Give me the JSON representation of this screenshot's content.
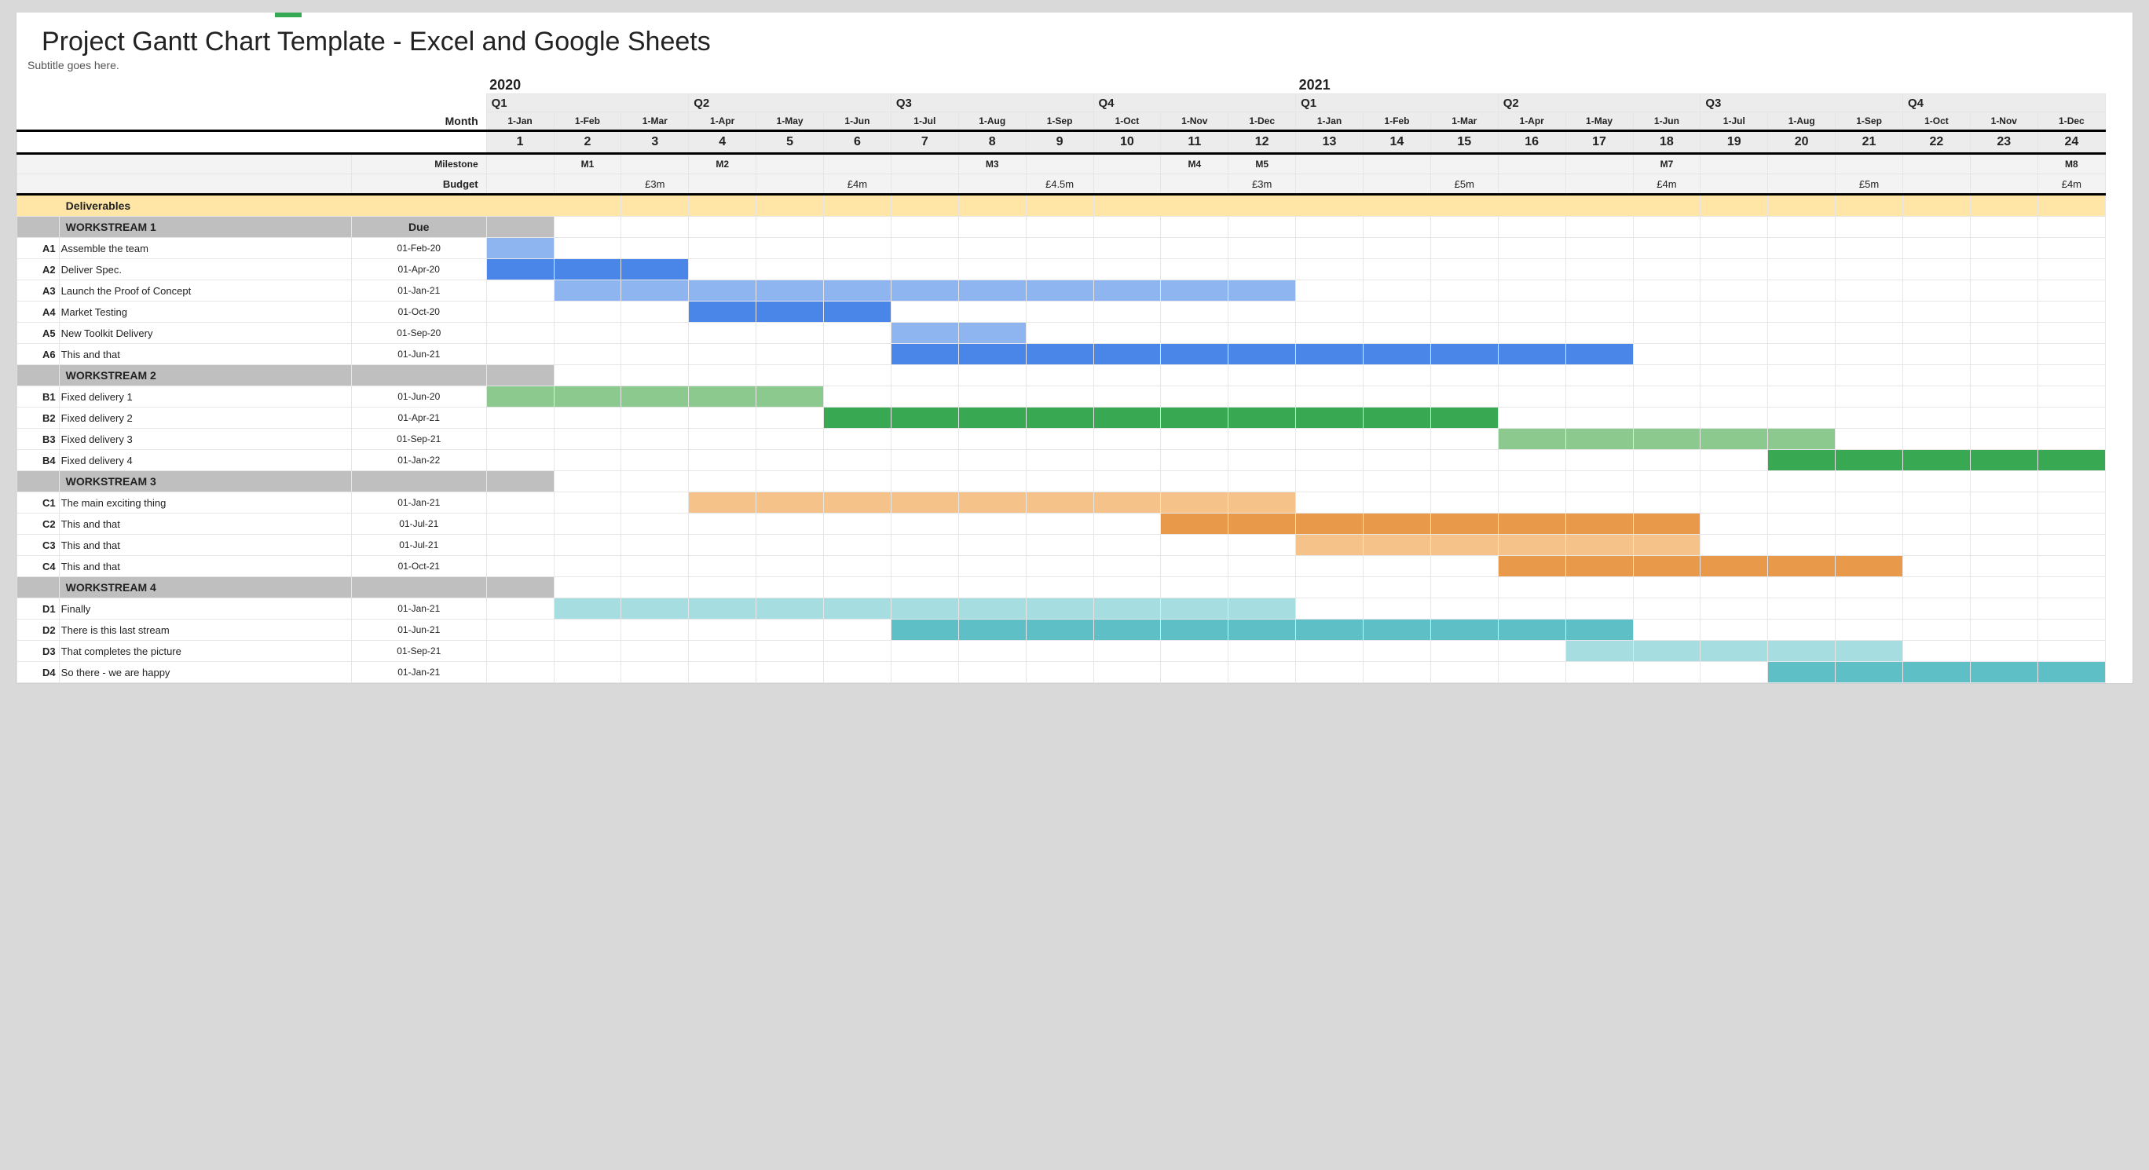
{
  "title": "Project Gantt Chart Template - Excel and Google Sheets",
  "subtitle": "Subtitle goes here.",
  "labels": {
    "month": "Month",
    "milestone": "Milestone",
    "budget": "Budget",
    "deliverables": "Deliverables",
    "due": "Due"
  },
  "years": [
    {
      "label": "2020",
      "col": 0
    },
    {
      "label": "2021",
      "col": 12
    }
  ],
  "quarters": [
    "Q1",
    "Q2",
    "Q3",
    "Q4",
    "Q1",
    "Q2",
    "Q3",
    "Q4"
  ],
  "months": [
    "1-Jan",
    "1-Feb",
    "1-Mar",
    "1-Apr",
    "1-May",
    "1-Jun",
    "1-Jul",
    "1-Aug",
    "1-Sep",
    "1-Oct",
    "1-Nov",
    "1-Dec",
    "1-Jan",
    "1-Feb",
    "1-Mar",
    "1-Apr",
    "1-May",
    "1-Jun",
    "1-Jul",
    "1-Aug",
    "1-Sep",
    "1-Oct",
    "1-Nov",
    "1-Dec"
  ],
  "month_nums": [
    "1",
    "2",
    "3",
    "4",
    "5",
    "6",
    "7",
    "8",
    "9",
    "10",
    "11",
    "12",
    "13",
    "14",
    "15",
    "16",
    "17",
    "18",
    "19",
    "20",
    "21",
    "22",
    "23",
    "24"
  ],
  "milestones": [
    "",
    "M1",
    "",
    "M2",
    "",
    "",
    "",
    "M3",
    "",
    "",
    "M4",
    "M5",
    "",
    "",
    "",
    "",
    "",
    "M7",
    "",
    "",
    "",
    "",
    "",
    "M8"
  ],
  "budgets": [
    "",
    "",
    "£3m",
    "",
    "",
    "£4m",
    "",
    "",
    "£4.5m",
    "",
    "",
    "£3m",
    "",
    "",
    "£5m",
    "",
    "",
    "£4m",
    "",
    "",
    "£5m",
    "",
    "",
    "£4m"
  ],
  "workstreams": [
    {
      "name": "WORKSTREAM 1",
      "color_main": "blue1",
      "color_light": "blue2",
      "tasks": [
        {
          "code": "A1",
          "name": "Assemble the team",
          "due": "01-Feb-20",
          "start": 0,
          "end": 0,
          "shade": "light"
        },
        {
          "code": "A2",
          "name": "Deliver Spec.",
          "due": "01-Apr-20",
          "start": 0,
          "end": 2,
          "shade": "main"
        },
        {
          "code": "A3",
          "name": "Launch the Proof of Concept",
          "due": "01-Jan-21",
          "start": 1,
          "end": 11,
          "shade": "light"
        },
        {
          "code": "A4",
          "name": "Market Testing",
          "due": "01-Oct-20",
          "start": 3,
          "end": 5,
          "shade": "main"
        },
        {
          "code": "A5",
          "name": "New Toolkit Delivery",
          "due": "01-Sep-20",
          "start": 6,
          "end": 7,
          "shade": "light"
        },
        {
          "code": "A6",
          "name": "This and that",
          "due": "01-Jun-21",
          "start": 6,
          "end": 16,
          "shade": "main"
        }
      ]
    },
    {
      "name": "WORKSTREAM 2",
      "color_main": "green1",
      "color_light": "green2",
      "tasks": [
        {
          "code": "B1",
          "name": "Fixed delivery 1",
          "due": "01-Jun-20",
          "start": 0,
          "end": 4,
          "shade": "light"
        },
        {
          "code": "B2",
          "name": "Fixed delivery 2",
          "due": "01-Apr-21",
          "start": 5,
          "end": 14,
          "shade": "main"
        },
        {
          "code": "B3",
          "name": "Fixed delivery 3",
          "due": "01-Sep-21",
          "start": 15,
          "end": 19,
          "shade": "light"
        },
        {
          "code": "B4",
          "name": "Fixed delivery 4",
          "due": "01-Jan-22",
          "start": 19,
          "end": 23,
          "shade": "main"
        }
      ]
    },
    {
      "name": "WORKSTREAM 3",
      "color_main": "orange1",
      "color_light": "orange2",
      "tasks": [
        {
          "code": "C1",
          "name": "The main exciting thing",
          "due": "01-Jan-21",
          "start": 3,
          "end": 11,
          "shade": "light"
        },
        {
          "code": "C2",
          "name": "This and that",
          "due": "01-Jul-21",
          "start": 10,
          "end": 17,
          "shade": "main"
        },
        {
          "code": "C3",
          "name": "This and that",
          "due": "01-Jul-21",
          "start": 12,
          "end": 17,
          "shade": "light"
        },
        {
          "code": "C4",
          "name": "This and that",
          "due": "01-Oct-21",
          "start": 15,
          "end": 20,
          "shade": "main"
        }
      ]
    },
    {
      "name": "WORKSTREAM 4",
      "color_main": "teal1",
      "color_light": "teal2",
      "tasks": [
        {
          "code": "D1",
          "name": "Finally",
          "due": "01-Jan-21",
          "start": 1,
          "end": 11,
          "shade": "light"
        },
        {
          "code": "D2",
          "name": "There is this last stream",
          "due": "01-Jun-21",
          "start": 6,
          "end": 16,
          "shade": "main"
        },
        {
          "code": "D3",
          "name": "That completes the picture",
          "due": "01-Sep-21",
          "start": 16,
          "end": 20,
          "shade": "light"
        },
        {
          "code": "D4",
          "name": "So there - we are happy",
          "due": "01-Jan-21",
          "start": 19,
          "end": 23,
          "shade": "main"
        }
      ]
    }
  ],
  "chart_data": {
    "type": "bar",
    "title": "Project Gantt Chart Template - Excel and Google Sheets",
    "xlabel": "Month",
    "ylabel": "",
    "categories": [
      "1-Jan-20",
      "1-Feb-20",
      "1-Mar-20",
      "1-Apr-20",
      "1-May-20",
      "1-Jun-20",
      "1-Jul-20",
      "1-Aug-20",
      "1-Sep-20",
      "1-Oct-20",
      "1-Nov-20",
      "1-Dec-20",
      "1-Jan-21",
      "1-Feb-21",
      "1-Mar-21",
      "1-Apr-21",
      "1-May-21",
      "1-Jun-21",
      "1-Jul-21",
      "1-Aug-21",
      "1-Sep-21",
      "1-Oct-21",
      "1-Nov-21",
      "1-Dec-21"
    ],
    "series": [
      {
        "name": "A1 Assemble the team",
        "start": 1,
        "end": 1
      },
      {
        "name": "A2 Deliver Spec.",
        "start": 1,
        "end": 3
      },
      {
        "name": "A3 Launch the Proof of Concept",
        "start": 2,
        "end": 12
      },
      {
        "name": "A4 Market Testing",
        "start": 4,
        "end": 6
      },
      {
        "name": "A5 New Toolkit Delivery",
        "start": 7,
        "end": 8
      },
      {
        "name": "A6 This and that",
        "start": 7,
        "end": 17
      },
      {
        "name": "B1 Fixed delivery 1",
        "start": 1,
        "end": 5
      },
      {
        "name": "B2 Fixed delivery 2",
        "start": 6,
        "end": 15
      },
      {
        "name": "B3 Fixed delivery 3",
        "start": 16,
        "end": 20
      },
      {
        "name": "B4 Fixed delivery 4",
        "start": 20,
        "end": 24
      },
      {
        "name": "C1 The main exciting thing",
        "start": 4,
        "end": 12
      },
      {
        "name": "C2 This and that",
        "start": 11,
        "end": 18
      },
      {
        "name": "C3 This and that",
        "start": 13,
        "end": 18
      },
      {
        "name": "C4 This and that",
        "start": 16,
        "end": 21
      },
      {
        "name": "D1 Finally",
        "start": 2,
        "end": 12
      },
      {
        "name": "D2 There is this last stream",
        "start": 7,
        "end": 17
      },
      {
        "name": "D3 That completes the picture",
        "start": 17,
        "end": 21
      },
      {
        "name": "D4 So there - we are happy",
        "start": 20,
        "end": 24
      }
    ],
    "milestones": [
      {
        "name": "M1",
        "month": 2
      },
      {
        "name": "M2",
        "month": 4
      },
      {
        "name": "M3",
        "month": 8
      },
      {
        "name": "M4",
        "month": 11
      },
      {
        "name": "M5",
        "month": 12
      },
      {
        "name": "M7",
        "month": 18
      },
      {
        "name": "M8",
        "month": 24
      }
    ],
    "budget_per_quarter": [
      "£3m",
      "£4m",
      "£4.5m",
      "£3m",
      "£5m",
      "£4m",
      "£5m",
      "£4m"
    ],
    "xlim": [
      1,
      24
    ]
  }
}
